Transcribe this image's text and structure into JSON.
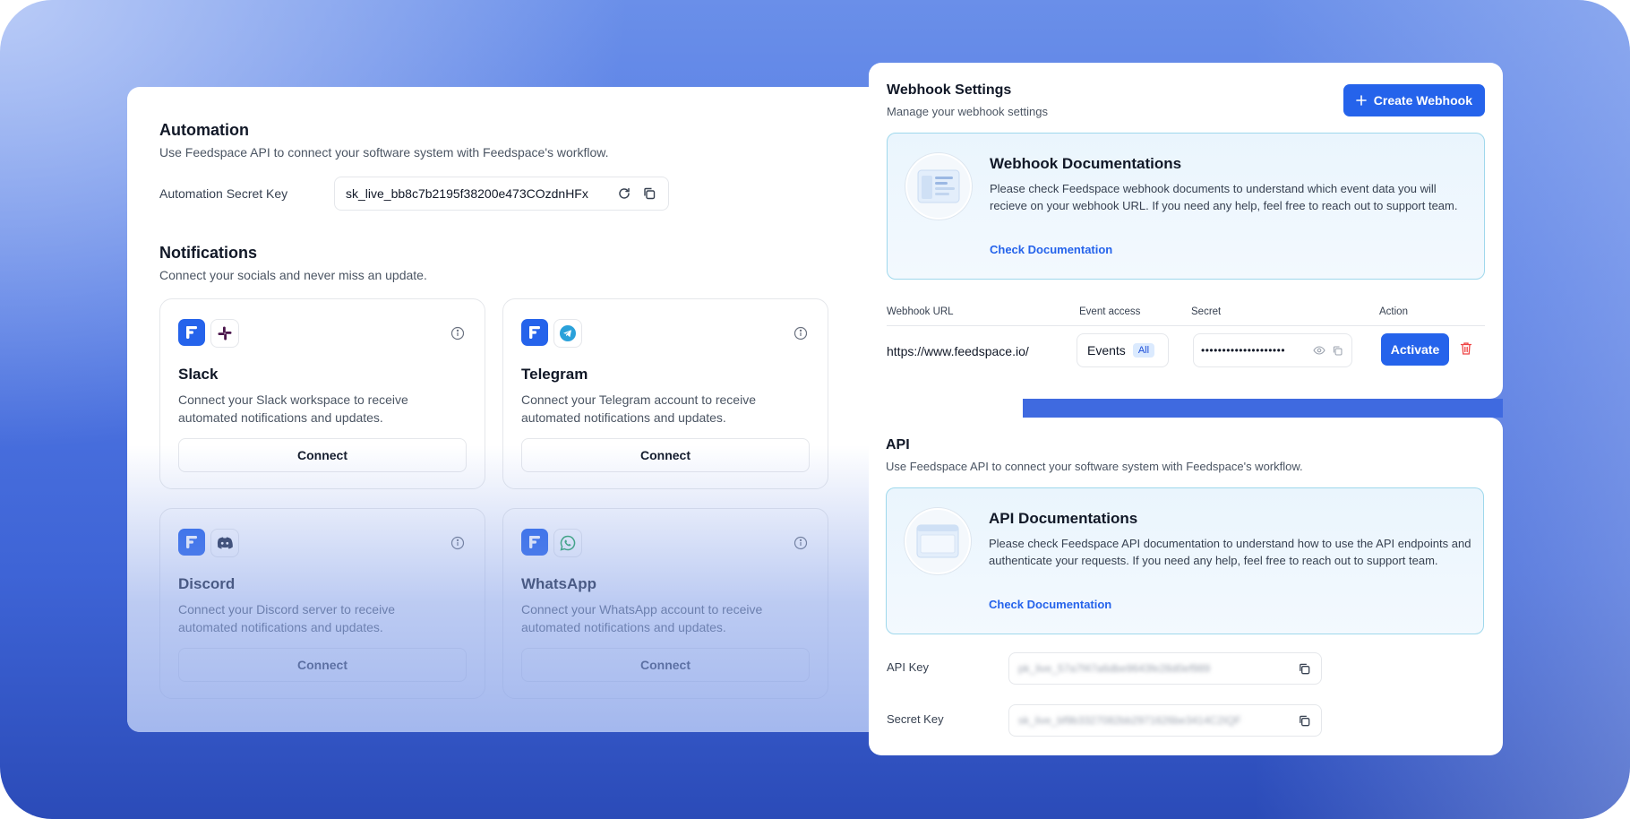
{
  "automation": {
    "title": "Automation",
    "subtitle": "Use Feedspace API to connect your software system with Feedspace's workflow.",
    "secret_key_label": "Automation Secret Key",
    "secret_key_value": "sk_live_bb8c7b2195f38200e473COzdnHFx"
  },
  "notifications": {
    "title": "Notifications",
    "subtitle": "Connect your socials and never miss an update.",
    "cards": [
      {
        "name": "Slack",
        "desc": "Connect your Slack workspace to receive automated notifications and updates.",
        "button": "Connect",
        "icon": "slack-icon"
      },
      {
        "name": "Telegram",
        "desc": "Connect your Telegram account to receive automated notifications and updates.",
        "button": "Connect",
        "icon": "telegram-icon"
      },
      {
        "name": "Discord",
        "desc": "Connect your Discord server to receive automated notifications and updates.",
        "button": "Connect",
        "icon": "discord-icon"
      },
      {
        "name": "WhatsApp",
        "desc": "Connect your WhatsApp account to receive automated notifications and updates.",
        "button": "Connect",
        "icon": "whatsapp-icon"
      }
    ]
  },
  "webhook": {
    "title": "Webhook Settings",
    "subtitle": "Manage your webhook settings",
    "create_button": "Create Webhook",
    "doc_title": "Webhook Documentations",
    "doc_text": "Please check Feedspace webhook documents to understand which event data you will recieve on your webhook URL. If you need any help, feel free to reach out to support team.",
    "doc_link": "Check Documentation",
    "columns": [
      "Webhook URL",
      "Event access",
      "Secret",
      "Action"
    ],
    "row": {
      "url": "https://www.feedspace.io/",
      "events_label": "Events",
      "events_badge": "All",
      "secret_masked": "••••••••••••••••••••",
      "action_button": "Activate"
    }
  },
  "api": {
    "title": "API",
    "subtitle": "Use Feedspace API to connect your software system with Feedspace's workflow.",
    "doc_title": "API Documentations",
    "doc_text": "Please check Feedspace API documentation to understand how to use the API endpoints and authenticate your requests. If you need any help, feel free to reach out to support team.",
    "doc_link": "Check Documentation",
    "api_key_label": "API Key",
    "api_key_value": "pk_live_57a7f47a6dbe9643fe28d0ef989",
    "secret_key_label": "Secret Key",
    "secret_key_value": "sk_live_bf9b3327082bb2971626be3414C2IQF"
  },
  "colors": {
    "accent": "#2563eb",
    "background_top": "#6a8fe9",
    "background_bottom": "#2b4bb8",
    "doc_border": "#9fd8ec",
    "danger": "#ef4444"
  }
}
